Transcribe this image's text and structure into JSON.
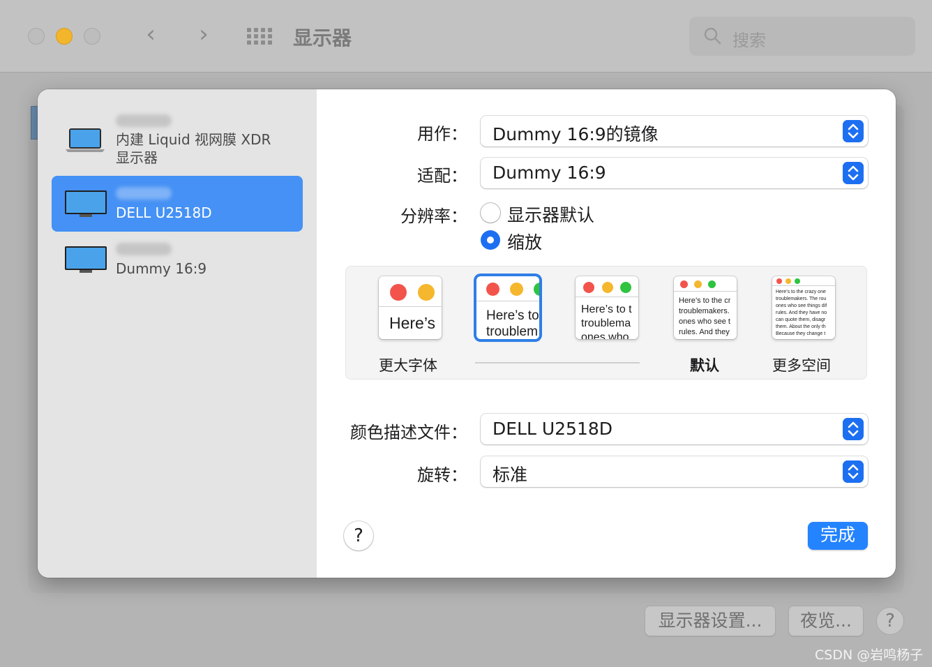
{
  "window": {
    "title": "显示器",
    "search_placeholder": "搜索",
    "bottom_buttons": {
      "display_settings": "显示器设置...",
      "night_shift": "夜览..."
    },
    "help": "?"
  },
  "watermark": "CSDN @岩鸣杨子",
  "sidebar": {
    "displays": [
      {
        "label": "内建 Liquid 视网膜 XDR\n显示器",
        "line1": "内建 Liquid 视网膜 XDR",
        "line2": "显示器",
        "icon": "laptop-icon",
        "selected": false
      },
      {
        "label": "DELL U2518D",
        "icon": "monitor-icon",
        "selected": true
      },
      {
        "label": "Dummy 16:9",
        "icon": "monitor-icon",
        "selected": false
      }
    ]
  },
  "settings": {
    "use_as": {
      "label": "用作：",
      "value": "Dummy 16:9的镜像"
    },
    "fit": {
      "label": "适配：",
      "value": "Dummy 16:9"
    },
    "resolution": {
      "label": "分辨率：",
      "options": [
        {
          "label": "显示器默认",
          "checked": false
        },
        {
          "label": "缩放",
          "checked": true
        }
      ]
    },
    "scales": {
      "captions": {
        "larger": "更大字体",
        "default": "默认",
        "more_space": "更多空间"
      },
      "thumb_texts": [
        "Here’s",
        "Here’s to\ntroublem",
        "Here’s to t\ntroublema\nones who",
        "Here’s to the cr\ntroublemakers.\nones who see t\nrules. And they",
        "Here’s to the crazy one\ntroublemakers. The rou\nones who see things dif\nrules. And they have no\ncan quote them, disagr\nthem. About the only th\nBecause they change t"
      ],
      "selected_index": 1
    },
    "color_profile": {
      "label": "颜色描述文件：",
      "value": "DELL U2518D"
    },
    "rotation": {
      "label": "旋转：",
      "value": "标准"
    }
  },
  "buttons": {
    "help": "?",
    "done": "完成"
  },
  "colors": {
    "accent": "#1d6ff2",
    "selected_row": "#4591f5",
    "done": "#2483ff"
  }
}
